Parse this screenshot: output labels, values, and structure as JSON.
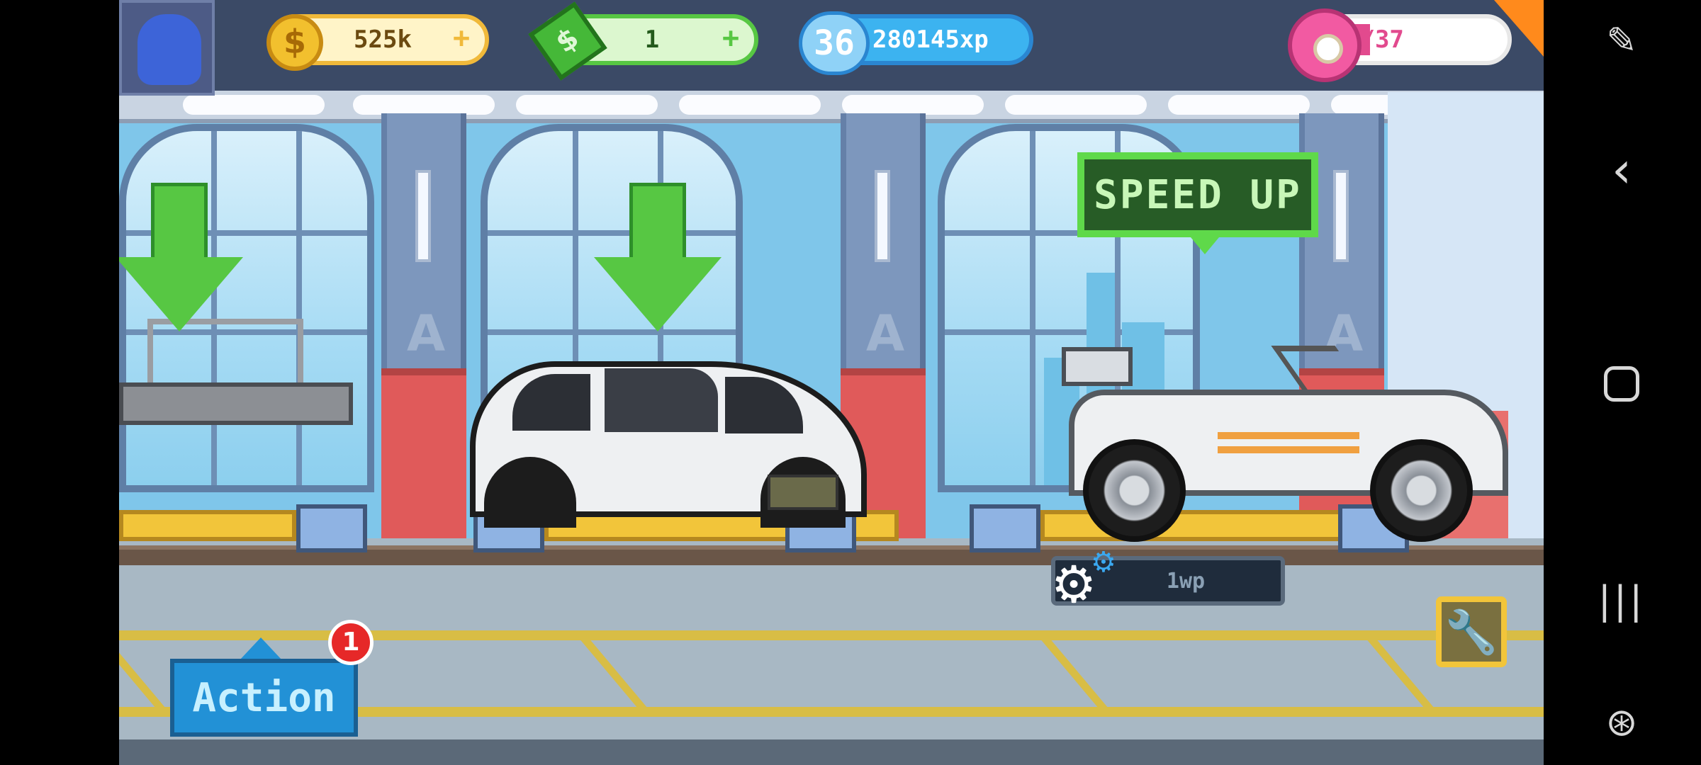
{
  "hud": {
    "coins": "525k",
    "cash": "1",
    "level": "36",
    "xp": "280145xp",
    "donuts": "5/37",
    "plus_symbol": "+"
  },
  "speed_up": {
    "label": "SPEED UP"
  },
  "work_points": {
    "label": "1wp"
  },
  "action": {
    "label": "Action",
    "badge_count": "1"
  },
  "icons": {
    "coin": "dollar-coin-icon",
    "cash": "dollar-bill-icon",
    "level": "level-star-badge-icon",
    "donut": "donut-icon",
    "gear": "gear-icon",
    "wrench": "wrench-icon",
    "screenshot": "screenshot-edit-icon",
    "back": "back-chevron-icon",
    "home": "home-square-icon",
    "recent": "recent-apps-icon",
    "game": "game-controller-icon"
  },
  "colors": {
    "coin_accent": "#f0b93a",
    "cash_accent": "#57c743",
    "xp_accent": "#3cb3f0",
    "donut_accent": "#e24a8e",
    "speed_up_accent": "#5fd94a",
    "action_accent": "#2291d6",
    "badge": "#e62828"
  }
}
